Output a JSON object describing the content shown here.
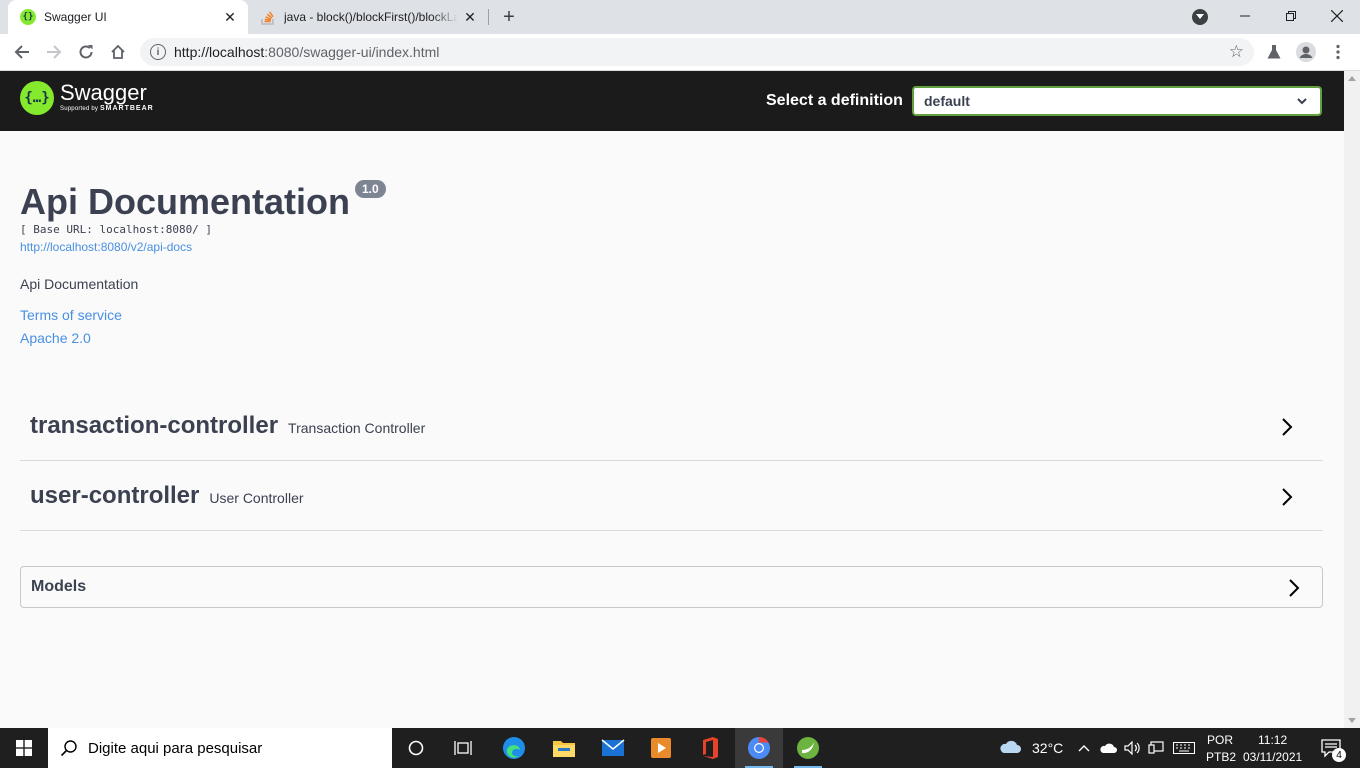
{
  "browser": {
    "tabs": [
      {
        "title": "Swagger UI",
        "favicon": "swagger-favicon",
        "active": true
      },
      {
        "title": "java - block()/blockFirst()/blockLast() are blocking",
        "favicon": "stackoverflow-favicon",
        "active": false
      }
    ],
    "new_tab_label": "+",
    "url_host": "http://localhost",
    "url_rest": ":8080/swagger-ui/index.html"
  },
  "swagger": {
    "logo_name": "Swagger",
    "logo_supported": "Supported by",
    "logo_brand": "SMARTBEAR",
    "definition_label": "Select a definition",
    "definition_value": "default",
    "accent_color": "#85ea2d",
    "topbar_color": "#1b1b1b"
  },
  "info": {
    "title": "Api Documentation",
    "version": "1.0",
    "base_url": "[ Base URL: localhost:8080/ ]",
    "api_docs_link": "http://localhost:8080/v2/api-docs",
    "description": "Api Documentation",
    "terms": "Terms of service",
    "license": "Apache 2.0"
  },
  "tags": [
    {
      "name": "transaction-controller",
      "description": "Transaction Controller"
    },
    {
      "name": "user-controller",
      "description": "User Controller"
    }
  ],
  "models": {
    "title": "Models"
  },
  "taskbar": {
    "search_placeholder": "Digite aqui para pesquisar",
    "weather": "32°C",
    "lang_1": "POR",
    "lang_2": "PTB2",
    "time": "11:12",
    "date": "03/11/2021",
    "notifications": "4"
  }
}
